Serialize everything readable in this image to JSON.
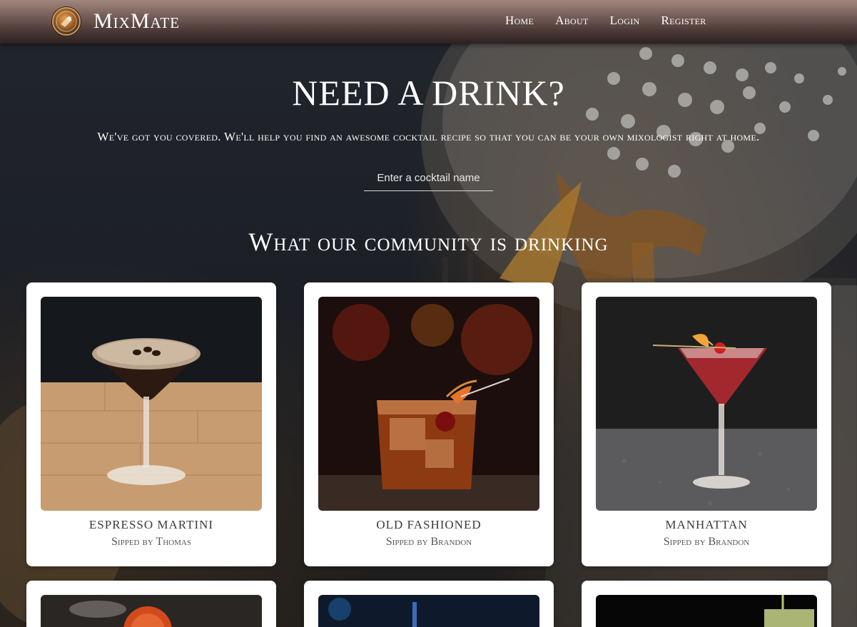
{
  "app": {
    "brand": "MixMate",
    "logo_icon": "cocktail-logo-icon"
  },
  "nav": {
    "links": [
      "Home",
      "About",
      "Login",
      "Register"
    ]
  },
  "hero": {
    "title": "NEED A DRINK?",
    "subtitle": "We've got you covered. We'll help you find an awesome cocktail recipe so that you can be your own mixologist right at home.",
    "search_placeholder": "Enter a cocktail name"
  },
  "community": {
    "title": "What our community is drinking",
    "cards": [
      {
        "name": "ESPRESSO MARTINI",
        "by": "Sipped by Thomas"
      },
      {
        "name": "OLD FASHIONED",
        "by": "Sipped by Brandon"
      },
      {
        "name": "MANHATTAN",
        "by": "Sipped by Brandon"
      }
    ]
  },
  "colors": {
    "navbar_top": "#a2867c",
    "navbar_bottom": "#2d2220",
    "card_bg": "#ffffff"
  }
}
